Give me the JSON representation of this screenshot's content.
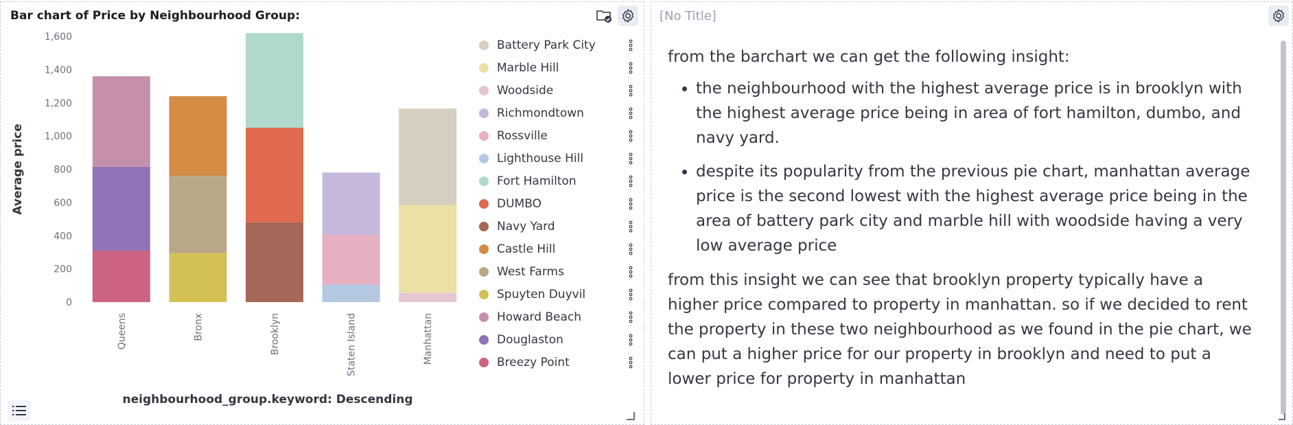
{
  "left_panel": {
    "title": "Bar chart of Price by Neighbourhood Group:"
  },
  "right_panel": {
    "title": "[No Title]",
    "intro": "from the barchart we can get the following insight:",
    "bullets": [
      "the neighbourhood with the highest average price is in brooklyn with the highest average price being in area of fort hamilton, dumbo, and navy yard.",
      "despite its popularity from the previous pie chart, manhattan average price is the second lowest with the highest average price being in the area of battery park city and marble hill with woodside having a very low average price"
    ],
    "conclusion": "from this insight we can see that brooklyn property typically have a higher price compared to property in manhattan. so if we decided to rent the property in these two neighbourhood as we found in the pie chart, we can put a higher price for our property in brooklyn and need to put a lower price for property in manhattan"
  },
  "chart_data": {
    "type": "bar",
    "stacked": true,
    "categories": [
      "Queens",
      "Bronx",
      "Brooklyn",
      "Staten Island",
      "Manhattan"
    ],
    "xlabel": "neighbourhood_group.keyword: Descending",
    "ylabel": "Average price",
    "ylim": [
      0,
      1600
    ],
    "yticks": [
      "0",
      "200",
      "400",
      "600",
      "800",
      "1,000",
      "1,200",
      "1,400",
      "1,600"
    ],
    "grid": false,
    "legend_position": "right",
    "series": [
      {
        "name": "Battery Park City",
        "color": "#d6cfbf",
        "values": [
          0,
          0,
          0,
          0,
          580
        ]
      },
      {
        "name": "Marble Hill",
        "color": "#ebe0a6",
        "values": [
          0,
          0,
          0,
          0,
          530
        ]
      },
      {
        "name": "Woodside",
        "color": "#e5c5d2",
        "values": [
          0,
          0,
          0,
          0,
          55
        ]
      },
      {
        "name": "Richmondtown",
        "color": "#c6b8db",
        "values": [
          0,
          0,
          0,
          375,
          0
        ]
      },
      {
        "name": "Rossville",
        "color": "#e6b0c0",
        "values": [
          0,
          0,
          0,
          300,
          0
        ]
      },
      {
        "name": "Lighthouse Hill",
        "color": "#b4c8e1",
        "values": [
          0,
          0,
          0,
          105,
          0
        ]
      },
      {
        "name": "Fort Hamilton",
        "color": "#b0d9cc",
        "values": [
          0,
          0,
          570,
          0,
          0
        ]
      },
      {
        "name": "DUMBO",
        "color": "#df6a4f",
        "values": [
          0,
          0,
          570,
          0,
          0
        ]
      },
      {
        "name": "Navy Yard",
        "color": "#a46758",
        "values": [
          0,
          0,
          480,
          0,
          0
        ]
      },
      {
        "name": "Castle Hill",
        "color": "#d48c45",
        "values": [
          0,
          0,
          0,
          0,
          0
        ]
      },
      {
        "name": "West Farms",
        "color": "#b8a887",
        "values": [
          0,
          465,
          0,
          0,
          0
        ]
      },
      {
        "name": "Spuyten Duyvil",
        "color": "#d4c156",
        "values": [
          0,
          295,
          0,
          0,
          0
        ]
      },
      {
        "name": "Howard Beach",
        "color": "#c690ac",
        "values": [
          545,
          0,
          0,
          0,
          0
        ]
      },
      {
        "name": "Douglaston",
        "color": "#9072b8",
        "values": [
          505,
          0,
          0,
          0,
          0
        ]
      },
      {
        "name": "Breezy Point",
        "color": "#cc6383",
        "values": [
          310,
          0,
          0,
          0,
          0
        ]
      }
    ],
    "extra_segments": [
      {
        "series": "Castle Hill",
        "category": "Bronx",
        "value": 480
      }
    ]
  }
}
